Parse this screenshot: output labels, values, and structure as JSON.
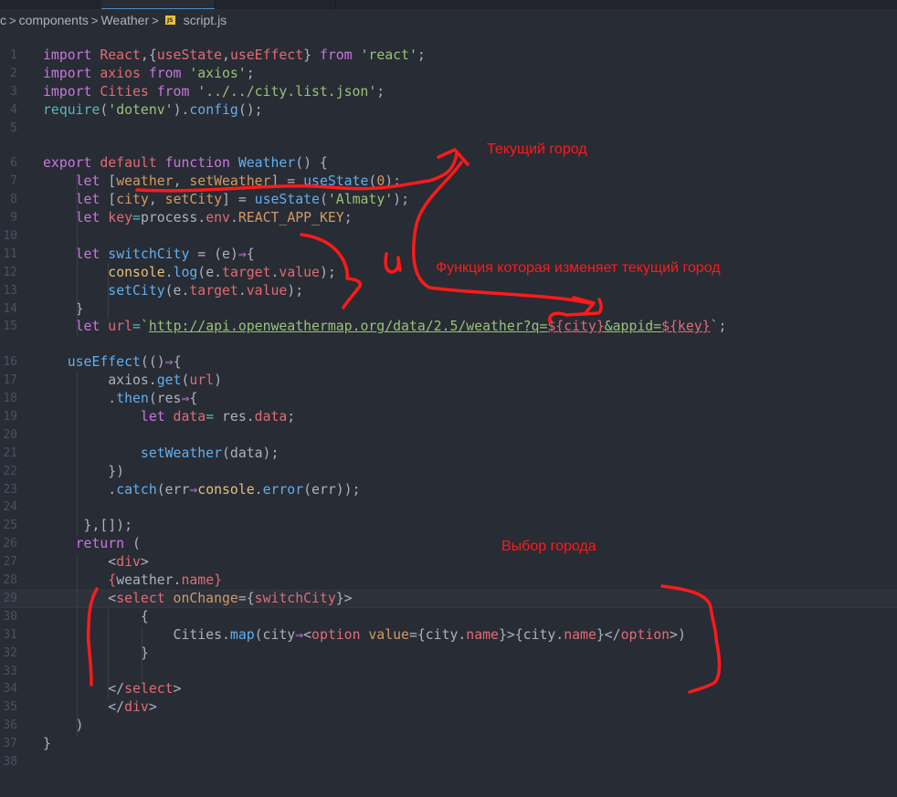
{
  "breadcrumb": {
    "items": [
      "c",
      "components",
      "Weather"
    ],
    "file": "script.js",
    "file_icon": "JS"
  },
  "editor": {
    "current_line": 29,
    "lines": [
      {
        "n": "1",
        "t": [
          [
            "kw",
            "import "
          ],
          [
            "var",
            "React"
          ],
          [
            "pl",
            ",{"
          ],
          [
            "var",
            "useState"
          ],
          [
            "pl",
            ","
          ],
          [
            "var",
            "useEffect"
          ],
          [
            "pl",
            "} "
          ],
          [
            "kw",
            "from "
          ],
          [
            "str",
            "'react'"
          ],
          [
            "pl",
            ";"
          ]
        ]
      },
      {
        "n": "2",
        "t": [
          [
            "kw",
            "import "
          ],
          [
            "var",
            "axios "
          ],
          [
            "kw",
            "from "
          ],
          [
            "str",
            "'axios'"
          ],
          [
            "pl",
            ";"
          ]
        ]
      },
      {
        "n": "3",
        "t": [
          [
            "kw",
            "import "
          ],
          [
            "var",
            "Cities "
          ],
          [
            "kw",
            "from "
          ],
          [
            "str",
            "'../../city.list.json'"
          ],
          [
            "pl",
            ";"
          ]
        ]
      },
      {
        "n": "4",
        "t": [
          [
            "cy",
            "require"
          ],
          [
            "pl",
            "("
          ],
          [
            "str",
            "'dotenv'"
          ],
          [
            "pl",
            ")."
          ],
          [
            "fn",
            "config"
          ],
          [
            "pl",
            "();"
          ]
        ]
      },
      {
        "n": "5",
        "t": [],
        "gap": true
      },
      {
        "n": "6",
        "t": [
          [
            "kw",
            "export "
          ],
          [
            "var",
            "default "
          ],
          [
            "kw",
            "function "
          ],
          [
            "fn",
            "Weather"
          ],
          [
            "pl",
            "() {"
          ]
        ]
      },
      {
        "n": "7",
        "t": [
          [
            "pl",
            "    "
          ],
          [
            "kw",
            "let "
          ],
          [
            "pl",
            "["
          ],
          [
            "num",
            "weather"
          ],
          [
            "pl",
            ", "
          ],
          [
            "num",
            "setWeather"
          ],
          [
            "pl",
            "] = "
          ],
          [
            "fn",
            "useState"
          ],
          [
            "pl",
            "("
          ],
          [
            "num",
            "0"
          ],
          [
            "pl",
            ");"
          ]
        ]
      },
      {
        "n": "8",
        "t": [
          [
            "pl",
            "    "
          ],
          [
            "kw",
            "let "
          ],
          [
            "pl",
            "["
          ],
          [
            "num",
            "city"
          ],
          [
            "pl",
            ", "
          ],
          [
            "num",
            "setCity"
          ],
          [
            "pl",
            "] = "
          ],
          [
            "fn",
            "useState"
          ],
          [
            "pl",
            "("
          ],
          [
            "str",
            "'Almaty'"
          ],
          [
            "pl",
            ");"
          ]
        ]
      },
      {
        "n": "9",
        "t": [
          [
            "pl",
            "    "
          ],
          [
            "kw",
            "let "
          ],
          [
            "var",
            "key"
          ],
          [
            "cy",
            "="
          ],
          [
            "pl",
            "process."
          ],
          [
            "var",
            "env"
          ],
          [
            "pl",
            "."
          ],
          [
            "num",
            "REACT_APP_KEY"
          ],
          [
            "pl",
            ";"
          ]
        ]
      },
      {
        "n": "10",
        "t": []
      },
      {
        "n": "11",
        "t": [
          [
            "pl",
            "    "
          ],
          [
            "kw",
            "let "
          ],
          [
            "fn",
            "switchCity "
          ],
          [
            "pl",
            "= (e)"
          ],
          [
            "kw",
            "⇒"
          ],
          [
            "pl",
            "{"
          ]
        ]
      },
      {
        "n": "12",
        "t": [
          [
            "pl",
            "        "
          ],
          [
            "con",
            "console"
          ],
          [
            "pl",
            "."
          ],
          [
            "fn",
            "log"
          ],
          [
            "pl",
            "(e."
          ],
          [
            "var",
            "target"
          ],
          [
            "pl",
            "."
          ],
          [
            "var",
            "value"
          ],
          [
            "pl",
            ");"
          ]
        ]
      },
      {
        "n": "13",
        "t": [
          [
            "pl",
            "        "
          ],
          [
            "fn",
            "setCity"
          ],
          [
            "pl",
            "(e."
          ],
          [
            "var",
            "target"
          ],
          [
            "pl",
            "."
          ],
          [
            "var",
            "value"
          ],
          [
            "pl",
            ");"
          ]
        ]
      },
      {
        "n": "14",
        "t": [
          [
            "pl",
            "    }"
          ]
        ]
      },
      {
        "n": "15",
        "t": [
          [
            "pl",
            "    "
          ],
          [
            "kw",
            "let "
          ],
          [
            "var",
            "url"
          ],
          [
            "cy",
            "="
          ],
          [
            "str",
            "`"
          ],
          [
            "url",
            "http://api.openweathermap.org/data/2.5/weather?q="
          ],
          [
            "tpl",
            "${city}"
          ],
          [
            "url",
            "&appid="
          ],
          [
            "tpl",
            "${key}"
          ],
          [
            "str",
            "`"
          ],
          [
            "pl",
            ";"
          ]
        ],
        "gap": true
      },
      {
        "n": "16",
        "t": [
          [
            "pl",
            "   "
          ],
          [
            "fn",
            "useEffect"
          ],
          [
            "pl",
            "(()"
          ],
          [
            "kw",
            "⇒"
          ],
          [
            "pl",
            "{"
          ]
        ]
      },
      {
        "n": "17",
        "t": [
          [
            "pl",
            "        axios."
          ],
          [
            "fn",
            "get"
          ],
          [
            "pl",
            "("
          ],
          [
            "var",
            "url"
          ],
          [
            "pl",
            ")"
          ]
        ]
      },
      {
        "n": "18",
        "t": [
          [
            "pl",
            "        ."
          ],
          [
            "fn",
            "then"
          ],
          [
            "pl",
            "(res"
          ],
          [
            "kw",
            "⇒"
          ],
          [
            "pl",
            "{"
          ]
        ]
      },
      {
        "n": "19",
        "t": [
          [
            "pl",
            "            "
          ],
          [
            "kw",
            "let "
          ],
          [
            "var",
            "data"
          ],
          [
            "cy",
            "= "
          ],
          [
            "pl",
            "res."
          ],
          [
            "var",
            "data"
          ],
          [
            "pl",
            ";"
          ]
        ]
      },
      {
        "n": "20",
        "t": []
      },
      {
        "n": "21",
        "t": [
          [
            "pl",
            "            "
          ],
          [
            "fn",
            "setWeather"
          ],
          [
            "pl",
            "(data);"
          ]
        ]
      },
      {
        "n": "22",
        "t": [
          [
            "pl",
            "        })"
          ]
        ]
      },
      {
        "n": "23",
        "t": [
          [
            "pl",
            "        ."
          ],
          [
            "fn",
            "catch"
          ],
          [
            "pl",
            "(err"
          ],
          [
            "kw",
            "⇒"
          ],
          [
            "con",
            "console"
          ],
          [
            "pl",
            "."
          ],
          [
            "fn",
            "error"
          ],
          [
            "pl",
            "(err));"
          ]
        ]
      },
      {
        "n": "24",
        "t": []
      },
      {
        "n": "25",
        "t": [
          [
            "pl",
            "     },[]);"
          ]
        ]
      },
      {
        "n": "26",
        "t": [
          [
            "pl",
            "    "
          ],
          [
            "kw",
            "return "
          ],
          [
            "pl",
            "("
          ]
        ]
      },
      {
        "n": "27",
        "t": [
          [
            "pl",
            "        <"
          ],
          [
            "var",
            "div"
          ],
          [
            "pl",
            ">"
          ]
        ]
      },
      {
        "n": "28",
        "t": [
          [
            "pl",
            "        "
          ],
          [
            "var",
            "{"
          ],
          [
            "pl",
            "weather."
          ],
          [
            "var",
            "name"
          ],
          [
            "var",
            "}"
          ]
        ]
      },
      {
        "n": "29",
        "t": [
          [
            "pl",
            "        <"
          ],
          [
            "var",
            "select "
          ],
          [
            "attr",
            "onChange"
          ],
          [
            "pl",
            "={"
          ],
          [
            "var",
            "switchCity"
          ],
          [
            "pl",
            "}>"
          ]
        ]
      },
      {
        "n": "30",
        "t": [
          [
            "pl",
            "            {"
          ]
        ]
      },
      {
        "n": "31",
        "t": [
          [
            "pl",
            "                Cities."
          ],
          [
            "fn",
            "map"
          ],
          [
            "pl",
            "(city"
          ],
          [
            "kw",
            "⇒"
          ],
          [
            "pl",
            "<"
          ],
          [
            "var",
            "option "
          ],
          [
            "attr",
            "value"
          ],
          [
            "pl",
            "={city."
          ],
          [
            "var",
            "name"
          ],
          [
            "pl",
            "}>{city."
          ],
          [
            "var",
            "name"
          ],
          [
            "pl",
            "}</"
          ],
          [
            "var",
            "option"
          ],
          [
            "pl",
            ">)"
          ]
        ]
      },
      {
        "n": "32",
        "t": [
          [
            "pl",
            "            }"
          ]
        ]
      },
      {
        "n": "33",
        "t": []
      },
      {
        "n": "34",
        "t": [
          [
            "pl",
            "        </"
          ],
          [
            "var",
            "select"
          ],
          [
            "pl",
            ">"
          ]
        ]
      },
      {
        "n": "35",
        "t": [
          [
            "pl",
            "        </"
          ],
          [
            "var",
            "div"
          ],
          [
            "pl",
            ">"
          ]
        ]
      },
      {
        "n": "36",
        "t": [
          [
            "pl",
            "    )"
          ]
        ]
      },
      {
        "n": "37",
        "t": [
          [
            "pl",
            "}"
          ]
        ]
      },
      {
        "n": "38",
        "t": []
      }
    ]
  },
  "annotations": {
    "current_city": "Текущий город",
    "function_label": "Функция которая изменяет текущий город",
    "and_mark": "и",
    "select_city": "Выбор города",
    "color": "#ff1a1a"
  },
  "theme": {
    "background": "#282c34",
    "keyword": "#c678dd",
    "variable": "#e06c75",
    "string": "#98c379",
    "function": "#61afef"
  }
}
